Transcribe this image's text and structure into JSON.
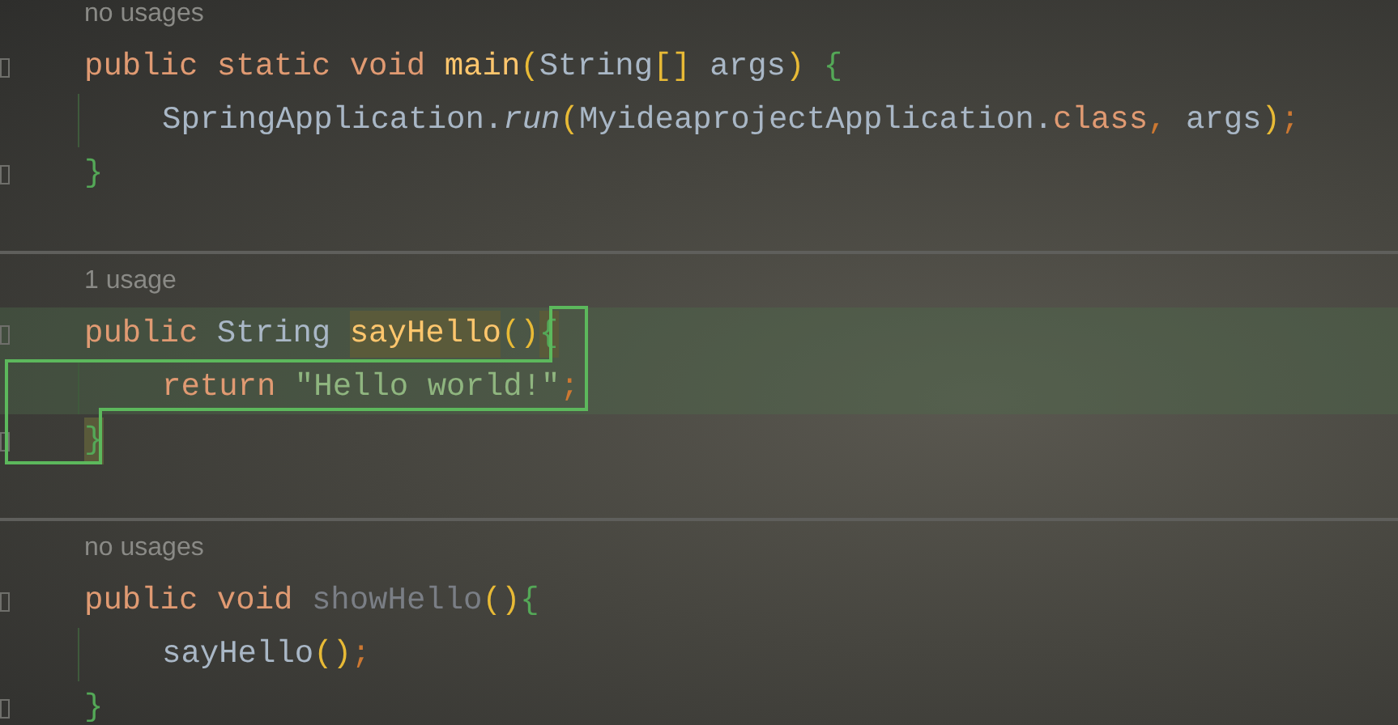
{
  "methods": [
    {
      "hint": "no usages",
      "lines": [
        {
          "indented": false,
          "current": false,
          "tokens": [
            {
              "kind": "keyword",
              "text": "public static void ",
              "matched": false
            },
            {
              "kind": "method",
              "text": "main",
              "matched": false
            },
            {
              "kind": "paren",
              "text": "(",
              "matched": false
            },
            {
              "kind": "type",
              "text": "String",
              "matched": false
            },
            {
              "kind": "paren",
              "text": "[]",
              "matched": false
            },
            {
              "kind": "type",
              "text": " args",
              "matched": false
            },
            {
              "kind": "paren",
              "text": ")",
              "matched": false
            },
            {
              "kind": "brace",
              "text": " {",
              "matched": false
            }
          ]
        },
        {
          "indented": true,
          "current": false,
          "tokens": [
            {
              "kind": "type",
              "text": "SpringApplication.",
              "matched": false
            },
            {
              "kind": "italic",
              "text": "run",
              "matched": false
            },
            {
              "kind": "paren",
              "text": "(",
              "matched": false
            },
            {
              "kind": "type",
              "text": "MyideaprojectApplication.",
              "matched": false
            },
            {
              "kind": "keyword",
              "text": "class",
              "matched": false
            },
            {
              "kind": "punct",
              "text": ", ",
              "matched": false
            },
            {
              "kind": "type",
              "text": "args",
              "matched": false
            },
            {
              "kind": "paren",
              "text": ")",
              "matched": false
            },
            {
              "kind": "punct",
              "text": ";",
              "matched": false
            }
          ]
        },
        {
          "indented": false,
          "current": false,
          "tokens": [
            {
              "kind": "brace",
              "text": "}",
              "matched": false
            }
          ]
        }
      ]
    },
    {
      "hint": "1 usage",
      "lines": [
        {
          "indented": false,
          "current": true,
          "tokens": [
            {
              "kind": "keyword",
              "text": "public ",
              "matched": false
            },
            {
              "kind": "type",
              "text": "String ",
              "matched": false
            },
            {
              "kind": "method",
              "text": "sayHello",
              "matched": true
            },
            {
              "kind": "paren",
              "text": "()",
              "matched": false
            },
            {
              "kind": "brace",
              "text": "{",
              "matched": true
            }
          ]
        },
        {
          "indented": true,
          "current": true,
          "tokens": [
            {
              "kind": "keyword",
              "text": "return ",
              "matched": false
            },
            {
              "kind": "string",
              "text": "\"Hello world!\"",
              "matched": false
            },
            {
              "kind": "punct",
              "text": ";",
              "matched": false
            }
          ]
        },
        {
          "indented": false,
          "current": false,
          "tokens": [
            {
              "kind": "brace",
              "text": "}",
              "matched": true
            }
          ]
        }
      ]
    },
    {
      "hint": "no usages",
      "lines": [
        {
          "indented": false,
          "current": false,
          "tokens": [
            {
              "kind": "keyword",
              "text": "public void ",
              "matched": false
            },
            {
              "kind": "unused",
              "text": "showHello",
              "matched": false
            },
            {
              "kind": "paren",
              "text": "()",
              "matched": false
            },
            {
              "kind": "brace",
              "text": "{",
              "matched": false
            }
          ]
        },
        {
          "indented": true,
          "current": false,
          "tokens": [
            {
              "kind": "type",
              "text": "sayHello",
              "matched": false
            },
            {
              "kind": "paren",
              "text": "()",
              "matched": false
            },
            {
              "kind": "punct",
              "text": ";",
              "matched": false
            }
          ]
        },
        {
          "indented": false,
          "current": false,
          "tokens": [
            {
              "kind": "brace",
              "text": "}",
              "matched": false
            }
          ]
        }
      ]
    }
  ]
}
